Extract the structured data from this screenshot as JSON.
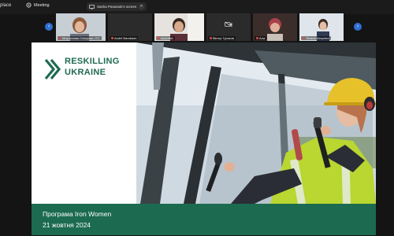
{
  "topbar": {
    "workspace": "place",
    "meeting_label": "Meeting",
    "share_label": "Sasha Panasiuk's screen",
    "close_glyph": "×"
  },
  "participants": [
    {
      "name": "Мирослава Сліпушко, СС",
      "video": true
    },
    {
      "name": "Andrii Barabash",
      "video": false
    },
    {
      "name": "ukolofski",
      "video": true
    },
    {
      "name": "Віктор Гусаков",
      "video": false
    },
    {
      "name": "Ала",
      "video": true
    },
    {
      "name": "Тетяна Шерліна",
      "video": true
    }
  ],
  "nav": {
    "prev": "‹",
    "next": "›"
  },
  "slide": {
    "brand_line1": "RESKILLING",
    "brand_line2": "UKRAINE",
    "footer_line1": "Програма Iron Women",
    "footer_line2": "21 жовтня 2024"
  },
  "colors": {
    "brand_green": "#1c6b50",
    "accent_blue": "#2f6fd4",
    "background": "#141414"
  }
}
